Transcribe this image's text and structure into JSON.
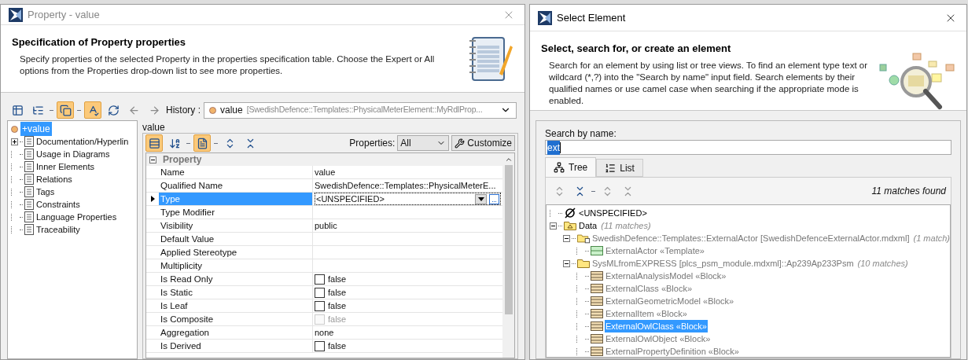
{
  "property_dialog": {
    "title": "Property - value",
    "header": {
      "title": "Specification of Property properties",
      "description": "Specify properties of the selected Property in the properties specification table. Choose the Expert or All options from the Properties drop-down list to see more properties."
    },
    "toolbar": [
      {
        "kind": "table",
        "pressed": false
      },
      {
        "kind": "tree",
        "pressed": false
      },
      {
        "kind": "separator"
      },
      {
        "kind": "windows",
        "pressed": true
      },
      {
        "kind": "separator"
      },
      {
        "kind": "abc",
        "pressed": true
      },
      {
        "kind": "refresh",
        "pressed": false
      },
      {
        "kind": "back",
        "pressed": false
      },
      {
        "kind": "forward",
        "pressed": false
      }
    ],
    "history": {
      "label": "History :",
      "name": "value",
      "path": "[SwedishDefence::Templates::PhysicalMeterElement::MyRdlProp..."
    },
    "tree": {
      "root": {
        "label": "+value",
        "selected": true
      },
      "items": [
        {
          "label": "Documentation/Hyperlin",
          "collapsed": true,
          "selected": false
        },
        {
          "label": "Usage in Diagrams",
          "collapsed": false,
          "selected": false
        },
        {
          "label": "Inner Elements",
          "collapsed": false,
          "selected": false
        },
        {
          "label": "Relations",
          "collapsed": false,
          "selected": false
        },
        {
          "label": "Tags",
          "collapsed": false,
          "selected": false
        },
        {
          "label": "Constraints",
          "collapsed": false,
          "selected": false
        },
        {
          "label": "Language Properties",
          "collapsed": false,
          "selected": false
        },
        {
          "label": "Traceability",
          "collapsed": false,
          "selected": false
        }
      ]
    },
    "group_label": "value",
    "table_toolbar": [
      {
        "kind": "categorized",
        "pressed": true
      },
      {
        "kind": "sort",
        "pressed": false
      },
      {
        "kind": "separator"
      },
      {
        "kind": "description",
        "pressed": true
      },
      {
        "kind": "separator"
      },
      {
        "kind": "expand",
        "pressed": false
      },
      {
        "kind": "collapse",
        "pressed": false
      }
    ],
    "properties_filter": {
      "label": "Properties:",
      "value": "All"
    },
    "customize_button": "Customize",
    "table": {
      "section": "Property",
      "section_expanded": true,
      "rows": [
        {
          "name": "Name",
          "value": "value",
          "kind": "text",
          "selected": false
        },
        {
          "name": "Qualified Name",
          "value": "SwedishDefence::Templates::PhysicalMeterE...",
          "kind": "text",
          "selected": false
        },
        {
          "name": "Type",
          "value": "<UNSPECIFIED>",
          "kind": "combo",
          "selected": true
        },
        {
          "name": "Type Modifier",
          "kind": "text",
          "selected": false
        },
        {
          "name": "Visibility",
          "value": "public",
          "kind": "text",
          "selected": false
        },
        {
          "name": "Default Value",
          "kind": "text",
          "selected": false
        },
        {
          "name": "Applied Stereotype",
          "kind": "text",
          "selected": false
        },
        {
          "name": "Multiplicity",
          "kind": "text",
          "selected": false
        },
        {
          "name": "Is Read Only",
          "value": "false",
          "kind": "checkbox",
          "checked": false,
          "disabled": false,
          "selected": false
        },
        {
          "name": "Is Static",
          "value": "false",
          "kind": "checkbox",
          "checked": false,
          "disabled": false,
          "selected": false
        },
        {
          "name": "Is Leaf",
          "value": "false",
          "kind": "checkbox",
          "checked": false,
          "disabled": false,
          "selected": false
        },
        {
          "name": "Is Composite",
          "value": "false",
          "kind": "checkbox",
          "checked": false,
          "disabled": true,
          "selected": false
        },
        {
          "name": "Aggregation",
          "value": "none",
          "kind": "text",
          "selected": false
        },
        {
          "name": "Is Derived",
          "value": "false",
          "kind": "checkbox",
          "checked": false,
          "disabled": false,
          "selected": false
        }
      ]
    }
  },
  "select_dialog": {
    "title": "Select Element",
    "header": {
      "title": "Select, search for, or create an element",
      "description": "Search for an element by using list or tree views. To find an element type text or wildcard (*,?) into the \"Search by name\" input field. Search elements by their qualified names or use camel case when searching if the appropriate mode is enabled."
    },
    "search": {
      "label": "Search by name:",
      "value": "ext"
    },
    "tabs": [
      {
        "label": "Tree",
        "kind": "tree",
        "selected": true
      },
      {
        "label": "List",
        "kind": "list",
        "selected": false
      }
    ],
    "tree_toolbar": [
      {
        "kind": "expand",
        "enabled": false
      },
      {
        "kind": "collapse",
        "enabled": true
      },
      {
        "kind": "separator"
      },
      {
        "kind": "expand-all",
        "enabled": false
      },
      {
        "kind": "collapse-all",
        "enabled": false
      }
    ],
    "match_summary": "11 matches found",
    "tree": [
      {
        "label": "<UNSPECIFIED>",
        "kind": "none",
        "dimmed": false,
        "selected": false
      },
      {
        "label": "Data",
        "kind": "package",
        "matches": "(11 matches)",
        "expanded": true,
        "dimmed": false,
        "selected": false,
        "children": [
          {
            "label": "SwedishDefence::Templates::ExternalActor [SwedishDefenceExternalActor.mdxml]",
            "kind": "module",
            "matches": "(1 match)",
            "expanded": true,
            "dimmed": true,
            "selected": false,
            "children": [
              {
                "label": "ExternalActor «Template»",
                "kind": "template",
                "dimmed": true,
                "selected": false
              }
            ]
          },
          {
            "label": "SysMLfromEXPRESS [plcs_psm_module.mdxml]::Ap239Ap233Psm",
            "kind": "folder",
            "matches": "(10 matches)",
            "expanded": true,
            "dimmed": true,
            "selected": false,
            "children": [
              {
                "label": "ExternalAnalysisModel «Block»",
                "kind": "block",
                "dimmed": true,
                "selected": false
              },
              {
                "label": "ExternalClass «Block»",
                "kind": "block",
                "dimmed": true,
                "selected": false
              },
              {
                "label": "ExternalGeometricModel «Block»",
                "kind": "block",
                "dimmed": true,
                "selected": false
              },
              {
                "label": "ExternalItem «Block»",
                "kind": "block",
                "dimmed": true,
                "selected": false
              },
              {
                "label": "ExternalOwlClass «Block»",
                "kind": "block",
                "dimmed": true,
                "selected": true
              },
              {
                "label": "ExternalOwlObject «Block»",
                "kind": "block",
                "dimmed": true,
                "selected": false
              },
              {
                "label": "ExternalPropertyDefinition «Block»",
                "kind": "block",
                "dimmed": true,
                "selected": false
              }
            ]
          }
        ]
      }
    ]
  }
}
